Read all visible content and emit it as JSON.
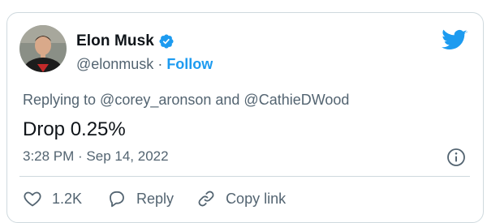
{
  "tweet": {
    "author": {
      "name": "Elon Musk",
      "handle": "@elonmusk",
      "separator": "·",
      "follow_label": "Follow",
      "verified_icon": "verified-badge-icon",
      "avatar": "avatar"
    },
    "replying_to": "Replying to @corey_aronson and @CathieDWood",
    "text": "Drop 0.25%",
    "timestamp": "3:28 PM · Sep 14, 2022",
    "actions": {
      "like_count": "1.2K",
      "reply_label": "Reply",
      "copy_link_label": "Copy link"
    },
    "icons": {
      "brand": "twitter-bird-icon",
      "info": "info-icon",
      "like": "heart-icon",
      "reply": "comment-bubble-icon",
      "copy_link": "link-icon"
    },
    "colors": {
      "accent": "#1d9bf0",
      "text_primary": "#0f1419",
      "text_secondary": "#536471",
      "border": "#cfd9de"
    }
  }
}
